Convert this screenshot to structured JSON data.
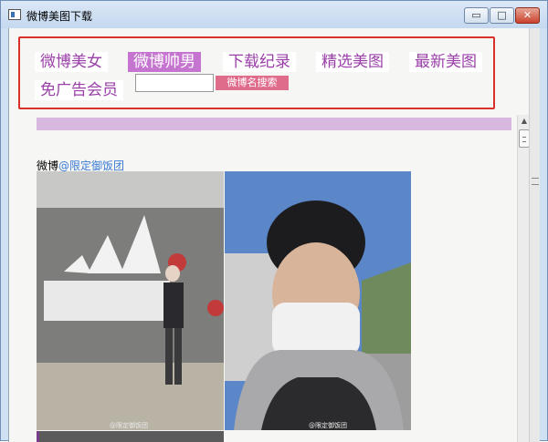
{
  "window": {
    "title": "微博美图下载",
    "minimize_label": "▭",
    "maximize_label": "□",
    "close_label": "✕"
  },
  "nav": {
    "items": [
      {
        "label": "微博美女"
      },
      {
        "label": "微博帅男",
        "active": true
      },
      {
        "label": "下载纪录"
      },
      {
        "label": "精选美图"
      },
      {
        "label": "最新美图"
      },
      {
        "label": "免广告会员"
      }
    ],
    "search": {
      "value": "",
      "button_label": "微博名搜索"
    }
  },
  "post": {
    "prefix": "微博",
    "user": "@限定御饭团",
    "photos": [
      {
        "icon": "photo-adidas-wall",
        "watermark": "@限定御饭团"
      },
      {
        "icon": "photo-masked-man",
        "watermark": "@限定御饭团"
      },
      {
        "icon": "photo-partial"
      }
    ]
  },
  "colors": {
    "nav_text": "#9a3fa8",
    "nav_active_bg": "#c574cf",
    "nav_box_border": "#d9302b",
    "divider_bar": "#d9b8e0",
    "search_button": "#e06c8c",
    "link": "#3b7bd6"
  }
}
